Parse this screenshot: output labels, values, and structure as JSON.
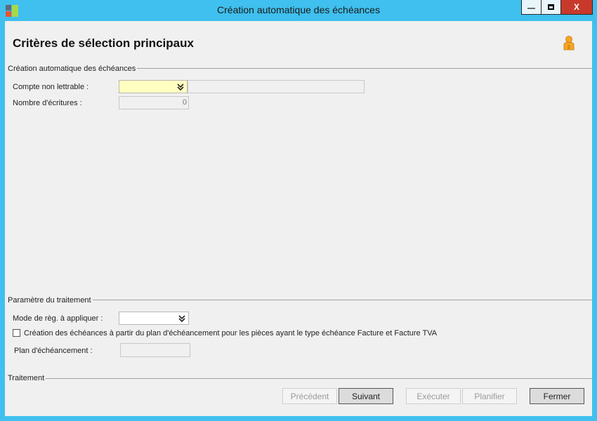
{
  "window": {
    "title": "Création automatique des échéances",
    "min_glyph": "—",
    "max_glyph": "□",
    "close_glyph": "X"
  },
  "header": {
    "title": "Critères de sélection principaux"
  },
  "section_main": {
    "label": "Création automatique des échéances",
    "compte_label": "Compte non lettrable :",
    "compte_value": "",
    "compte_desc": "",
    "nombre_label": "Nombre d'écritures :",
    "nombre_value": "0"
  },
  "section_params": {
    "label": "Paramètre du traitement",
    "mode_label": "Mode de règ. à appliquer :",
    "mode_value": "",
    "checkbox_label": "Création des échéances à partir du plan d'échéancement pour les pièces ayant le type échéance Facture et Facture TVA",
    "checkbox_checked": false,
    "plan_label": "Plan d'échéancement :",
    "plan_value": ""
  },
  "section_traitement": {
    "label": "Traitement"
  },
  "buttons": {
    "precedent": "Précédent",
    "suivant": "Suivant",
    "executer": "Exécuter",
    "planifier": "Planifier",
    "fermer": "Fermer"
  },
  "colors": {
    "titlebar": "#3fc0ee",
    "close_button": "#c7392b",
    "required_field": "#ffffc0",
    "client_bg": "#f0f0f0"
  },
  "icons": {
    "app": "app-icon",
    "user": "user-icon",
    "dropdown": "double-chevron-down-icon"
  }
}
